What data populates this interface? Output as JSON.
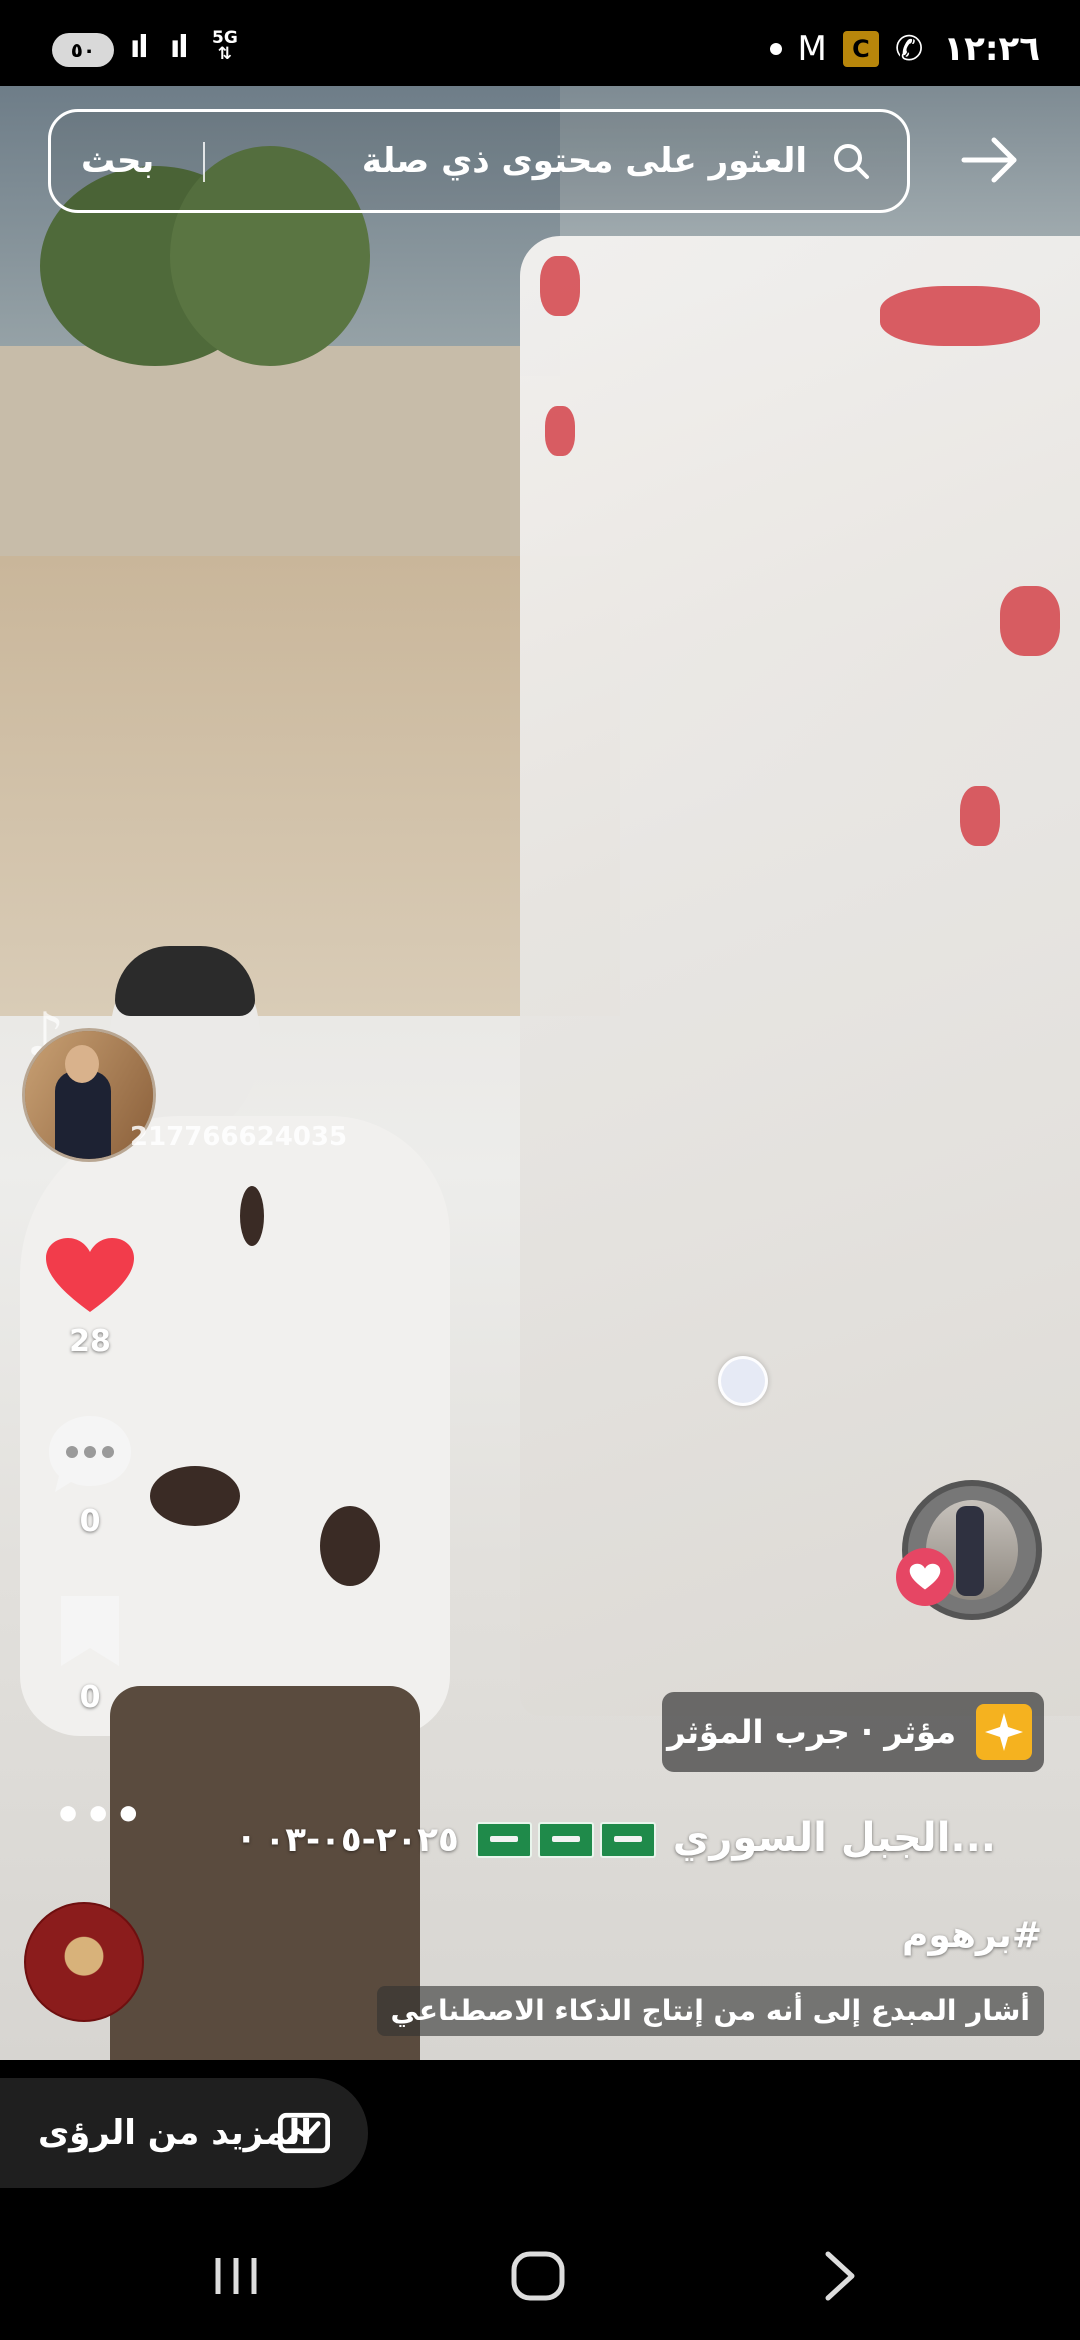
{
  "status_bar": {
    "battery": "٥٠",
    "network": "5G",
    "time": "١٢:٢٦",
    "icons": [
      "battery-icon",
      "signal-icon",
      "signal-icon",
      "dot-icon",
      "gmail-icon",
      "app-c-icon",
      "whatsapp-icon"
    ]
  },
  "search": {
    "placeholder": "العثور على محتوى ذي صلة",
    "button_label": "بحث",
    "icon": "search-icon",
    "back_icon": "arrow-right-icon"
  },
  "creator": {
    "watermark_id": "217766624035"
  },
  "actions": {
    "likes": "28",
    "comments": "0",
    "favorites": "0"
  },
  "effect": {
    "label": "مؤثر · جرب المؤثر"
  },
  "caption": {
    "title": "...الجبل السوري",
    "date": "٢٠٢٥-٠٥-٠٣ ·",
    "hashtag": "#برهوم",
    "ai_notice": "أشار المبدع إلى أنه من إنتاج الذكاء الاصطناعي"
  },
  "more_label": "•••",
  "insights": {
    "label": "المزيد من الرؤى"
  },
  "colors": {
    "like": "#f23c4b",
    "effect_icon": "#f5b21f",
    "background": "#000000"
  }
}
